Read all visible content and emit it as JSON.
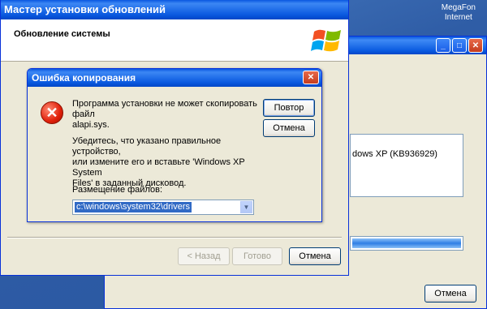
{
  "tray": {
    "line1": "MegaFon",
    "line2": "Internet"
  },
  "background_window": {
    "panel_text": "dows XP (KB936929)",
    "progress": 1.0,
    "cancel_label": "Отмена"
  },
  "wizard": {
    "title": "Мастер установки обновлений",
    "header_title": "Обновление системы",
    "back_label": "< Назад",
    "finish_label": "Готово",
    "cancel_label": "Отмена"
  },
  "dialog": {
    "title": "Ошибка копирования",
    "message1_line1": "Программа установки не может скопировать файл",
    "message1_line2": "alapi.sys.",
    "message2_line1": "Убедитесь, что указано правильное устройство,",
    "message2_line2": "или измените его и вставьте 'Windows XP System",
    "message2_line3": "Files' в заданный дисковод.",
    "location_label": "Размещение файлов:",
    "location_value": "c:\\windows\\system32\\drivers",
    "retry_label": "Повтор",
    "cancel_label": "Отмена"
  },
  "icons": {
    "error": "error-icon",
    "close": "close-icon",
    "dropdown": "chevron-down-icon",
    "logo": "windows-logo-icon"
  },
  "colors": {
    "titlebar": "#0a58e0",
    "selection": "#316ac5",
    "window_bg": "#ece9d8"
  }
}
